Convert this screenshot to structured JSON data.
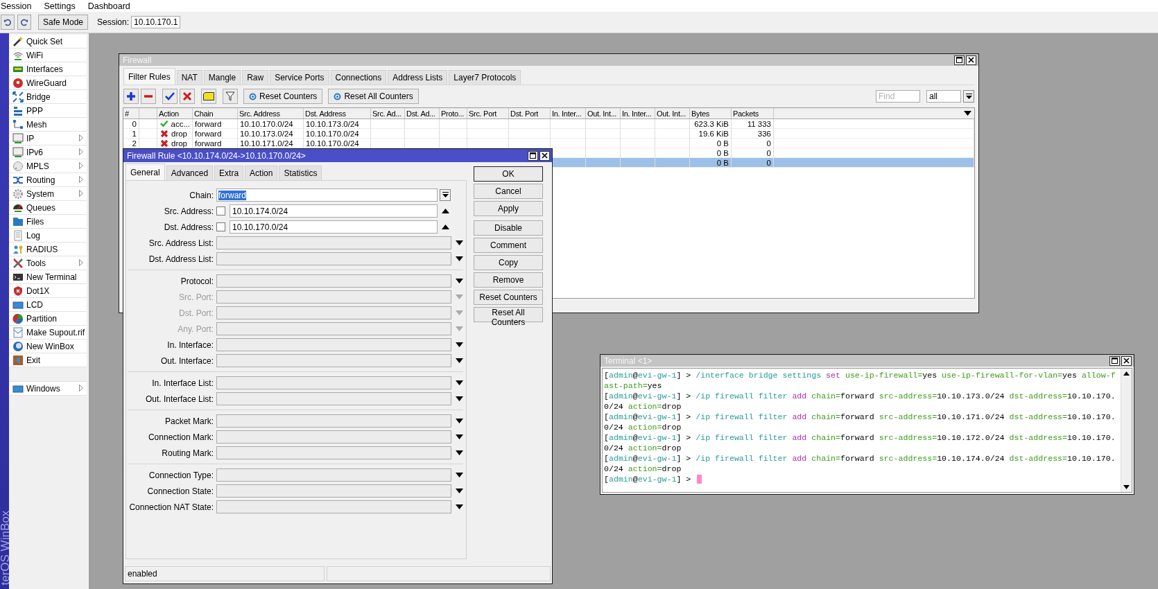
{
  "menu_bar": {
    "items": [
      "Session",
      "Settings",
      "Dashboard"
    ]
  },
  "toolbar": {
    "safe_mode": "Safe Mode",
    "session_label": "Session:",
    "session_value": "10.10.170.1"
  },
  "sidebar": {
    "brand": "terOS WinBox",
    "items": [
      {
        "label": "Quick Set",
        "submenu": false
      },
      {
        "label": "WiFi",
        "submenu": false
      },
      {
        "label": "Interfaces",
        "submenu": false
      },
      {
        "label": "WireGuard",
        "submenu": false
      },
      {
        "label": "Bridge",
        "submenu": false
      },
      {
        "label": "PPP",
        "submenu": false
      },
      {
        "label": "Mesh",
        "submenu": false
      },
      {
        "label": "IP",
        "submenu": true
      },
      {
        "label": "IPv6",
        "submenu": true
      },
      {
        "label": "MPLS",
        "submenu": true
      },
      {
        "label": "Routing",
        "submenu": true
      },
      {
        "label": "System",
        "submenu": true
      },
      {
        "label": "Queues",
        "submenu": false
      },
      {
        "label": "Files",
        "submenu": false
      },
      {
        "label": "Log",
        "submenu": false
      },
      {
        "label": "RADIUS",
        "submenu": false
      },
      {
        "label": "Tools",
        "submenu": true
      },
      {
        "label": "New Terminal",
        "submenu": false
      },
      {
        "label": "Dot1X",
        "submenu": false
      },
      {
        "label": "LCD",
        "submenu": false
      },
      {
        "label": "Partition",
        "submenu": false
      },
      {
        "label": "Make Supout.rif",
        "submenu": false
      },
      {
        "label": "New WinBox",
        "submenu": false
      },
      {
        "label": "Exit",
        "submenu": false
      }
    ],
    "windows_item": {
      "label": "Windows",
      "submenu": true
    }
  },
  "firewall": {
    "title": "Firewall",
    "tabs": [
      {
        "label": "Filter Rules",
        "selected": true
      },
      {
        "label": "NAT",
        "selected": false
      },
      {
        "label": "Mangle",
        "selected": false
      },
      {
        "label": "Raw",
        "selected": false
      },
      {
        "label": "Service Ports",
        "selected": false
      },
      {
        "label": "Connections",
        "selected": false
      },
      {
        "label": "Address Lists",
        "selected": false
      },
      {
        "label": "Layer7 Protocols",
        "selected": false
      }
    ],
    "buttons": [
      "Reset Counters",
      "Reset All Counters"
    ],
    "find": {
      "placeholder": "Find"
    },
    "filter_value": "all",
    "columns": [
      "#",
      "Action",
      "Chain",
      "Src. Address",
      "Dst. Address",
      "Src. Ad...",
      "Dst. Ad...",
      "Proto...",
      "Src. Port",
      "Dst. Port",
      "In. Inter...",
      "Out. Int...",
      "In. Inter...",
      "Out. Int...",
      "Bytes",
      "Packets"
    ],
    "rows": [
      {
        "num": "0",
        "kind": "accept",
        "action": "acc...",
        "chain": "forward",
        "src_address": "10.10.170.0/24",
        "dst_address": "10.10.173.0/24",
        "bytes": "623.3 KiB",
        "packets": "11 333",
        "selected": false
      },
      {
        "num": "1",
        "kind": "drop",
        "action": "drop",
        "chain": "forward",
        "src_address": "10.10.173.0/24",
        "dst_address": "10.10.170.0/24",
        "bytes": "19.6 KiB",
        "packets": "336",
        "selected": false
      },
      {
        "num": "2",
        "kind": "drop",
        "action": "drop",
        "chain": "forward",
        "src_address": "10.10.171.0/24",
        "dst_address": "10.10.170.0/24",
        "bytes": "0 B",
        "packets": "0",
        "selected": false
      },
      {
        "bytes": "0 B",
        "packets": "0",
        "selected": false
      },
      {
        "bytes": "0 B",
        "packets": "0",
        "selected": true
      }
    ]
  },
  "rule_dialog": {
    "title": "Firewall Rule <10.10.174.0/24->10.10.170.0/24>",
    "tabs": [
      {
        "label": "General",
        "selected": true
      },
      {
        "label": "Advanced",
        "selected": false
      },
      {
        "label": "Extra",
        "selected": false
      },
      {
        "label": "Action",
        "selected": false
      },
      {
        "label": "Statistics",
        "selected": false
      }
    ],
    "groups": [
      [
        {
          "label": "Chain:",
          "value": "forward",
          "kind": "combo",
          "highlighted": true,
          "disabled": false
        },
        {
          "label": "Src. Address:",
          "value": "10.10.174.0/24",
          "kind": "address",
          "negated": false,
          "highlighted": false,
          "disabled": false
        },
        {
          "label": "Dst. Address:",
          "value": "10.10.170.0/24",
          "kind": "address",
          "negated": false,
          "highlighted": false,
          "disabled": false
        },
        {
          "label": "Src. Address List:",
          "kind": "list",
          "disabled": false
        },
        {
          "label": "Dst. Address List:",
          "kind": "list",
          "disabled": false
        }
      ],
      [
        {
          "label": "Protocol:",
          "kind": "list",
          "disabled": false
        },
        {
          "label": "Src. Port:",
          "kind": "list",
          "disabled": true
        },
        {
          "label": "Dst. Port:",
          "kind": "list",
          "disabled": true
        },
        {
          "label": "Any. Port:",
          "kind": "list",
          "disabled": true
        },
        {
          "label": "In. Interface:",
          "kind": "list",
          "disabled": false
        },
        {
          "label": "Out. Interface:",
          "kind": "list",
          "disabled": false
        }
      ],
      [
        {
          "label": "In. Interface List:",
          "kind": "list",
          "disabled": false
        },
        {
          "label": "Out. Interface List:",
          "kind": "list",
          "disabled": false
        }
      ],
      [
        {
          "label": "Packet Mark:",
          "kind": "list",
          "disabled": false
        },
        {
          "label": "Connection Mark:",
          "kind": "list",
          "disabled": false
        },
        {
          "label": "Routing Mark:",
          "kind": "list",
          "disabled": false
        }
      ],
      [
        {
          "label": "Connection Type:",
          "kind": "list",
          "disabled": false
        },
        {
          "label": "Connection State:",
          "kind": "list",
          "disabled": false
        },
        {
          "label": "Connection NAT State:",
          "kind": "list",
          "disabled": false
        }
      ]
    ],
    "button_groups": [
      [
        {
          "label": "OK",
          "default": true
        },
        {
          "label": "Cancel",
          "default": false
        },
        {
          "label": "Apply",
          "default": false
        }
      ],
      [
        {
          "label": "Disable",
          "default": false
        },
        {
          "label": "Comment",
          "default": false
        },
        {
          "label": "Copy",
          "default": false
        },
        {
          "label": "Remove",
          "default": false
        },
        {
          "label": "Reset Counters",
          "default": false
        },
        {
          "label": "Reset All Counters",
          "default": false
        }
      ]
    ],
    "status": "enabled"
  },
  "terminal": {
    "title": "Terminal <1>",
    "cursor": true,
    "lines": [
      [
        {
          "text": "["
        },
        {
          "text": "admin",
          "color": "#279a9a"
        },
        {
          "text": "@"
        },
        {
          "text": "evi-gw-1",
          "color": "#279a9a"
        },
        {
          "text": "] > "
        },
        {
          "text": "/interface bridge settings",
          "color": "#279a9a"
        },
        {
          "text": " set",
          "color": "#b02ab0"
        },
        {
          "text": " use-ip-firewall=",
          "color": "#3d9a1c"
        },
        {
          "text": "yes"
        },
        {
          "text": " use-ip-firewall-for-vlan=",
          "color": "#3d9a1c"
        },
        {
          "text": "yes"
        },
        {
          "text": " allow-f",
          "color": "#3d9a1c"
        }
      ],
      [
        {
          "text": "ast-path=",
          "color": "#3d9a1c"
        },
        {
          "text": "yes"
        }
      ],
      [
        {
          "text": "["
        },
        {
          "text": "admin",
          "color": "#279a9a"
        },
        {
          "text": "@"
        },
        {
          "text": "evi-gw-1",
          "color": "#279a9a"
        },
        {
          "text": "] > "
        },
        {
          "text": "/ip firewall filter",
          "color": "#279a9a"
        },
        {
          "text": " add",
          "color": "#b02ab0"
        },
        {
          "text": " chain=",
          "color": "#3d9a1c"
        },
        {
          "text": "forward"
        },
        {
          "text": " src-address=",
          "color": "#3d9a1c"
        },
        {
          "text": "10.10.173.0/24"
        },
        {
          "text": " dst-address=",
          "color": "#3d9a1c"
        },
        {
          "text": "10.10.170."
        }
      ],
      [
        {
          "text": "0/24"
        },
        {
          "text": " action=",
          "color": "#3d9a1c"
        },
        {
          "text": "drop"
        }
      ],
      [
        {
          "text": "["
        },
        {
          "text": "admin",
          "color": "#279a9a"
        },
        {
          "text": "@"
        },
        {
          "text": "evi-gw-1",
          "color": "#279a9a"
        },
        {
          "text": "] > "
        },
        {
          "text": "/ip firewall filter",
          "color": "#279a9a"
        },
        {
          "text": " add",
          "color": "#b02ab0"
        },
        {
          "text": " chain=",
          "color": "#3d9a1c"
        },
        {
          "text": "forward"
        },
        {
          "text": " src-address=",
          "color": "#3d9a1c"
        },
        {
          "text": "10.10.171.0/24"
        },
        {
          "text": " dst-address=",
          "color": "#3d9a1c"
        },
        {
          "text": "10.10.170."
        }
      ],
      [
        {
          "text": "0/24"
        },
        {
          "text": " action=",
          "color": "#3d9a1c"
        },
        {
          "text": "drop"
        }
      ],
      [
        {
          "text": "["
        },
        {
          "text": "admin",
          "color": "#279a9a"
        },
        {
          "text": "@"
        },
        {
          "text": "evi-gw-1",
          "color": "#279a9a"
        },
        {
          "text": "] > "
        },
        {
          "text": "/ip firewall filter",
          "color": "#279a9a"
        },
        {
          "text": " add",
          "color": "#b02ab0"
        },
        {
          "text": " chain=",
          "color": "#3d9a1c"
        },
        {
          "text": "forward"
        },
        {
          "text": " src-address=",
          "color": "#3d9a1c"
        },
        {
          "text": "10.10.172.0/24"
        },
        {
          "text": " dst-address=",
          "color": "#3d9a1c"
        },
        {
          "text": "10.10.170."
        }
      ],
      [
        {
          "text": "0/24"
        },
        {
          "text": " action=",
          "color": "#3d9a1c"
        },
        {
          "text": "drop"
        }
      ],
      [
        {
          "text": "["
        },
        {
          "text": "admin",
          "color": "#279a9a"
        },
        {
          "text": "@"
        },
        {
          "text": "evi-gw-1",
          "color": "#279a9a"
        },
        {
          "text": "] > "
        },
        {
          "text": "/ip firewall filter",
          "color": "#279a9a"
        },
        {
          "text": " add",
          "color": "#b02ab0"
        },
        {
          "text": " chain=",
          "color": "#3d9a1c"
        },
        {
          "text": "forward"
        },
        {
          "text": " src-address=",
          "color": "#3d9a1c"
        },
        {
          "text": "10.10.174.0/24"
        },
        {
          "text": " dst-address=",
          "color": "#3d9a1c"
        },
        {
          "text": "10.10.170."
        }
      ],
      [
        {
          "text": "0/24"
        },
        {
          "text": " action=",
          "color": "#3d9a1c"
        },
        {
          "text": "drop"
        }
      ],
      [
        {
          "text": "["
        },
        {
          "text": "admin",
          "color": "#279a9a"
        },
        {
          "text": "@"
        },
        {
          "text": "evi-gw-1",
          "color": "#279a9a"
        },
        {
          "text": "] > "
        }
      ]
    ]
  }
}
